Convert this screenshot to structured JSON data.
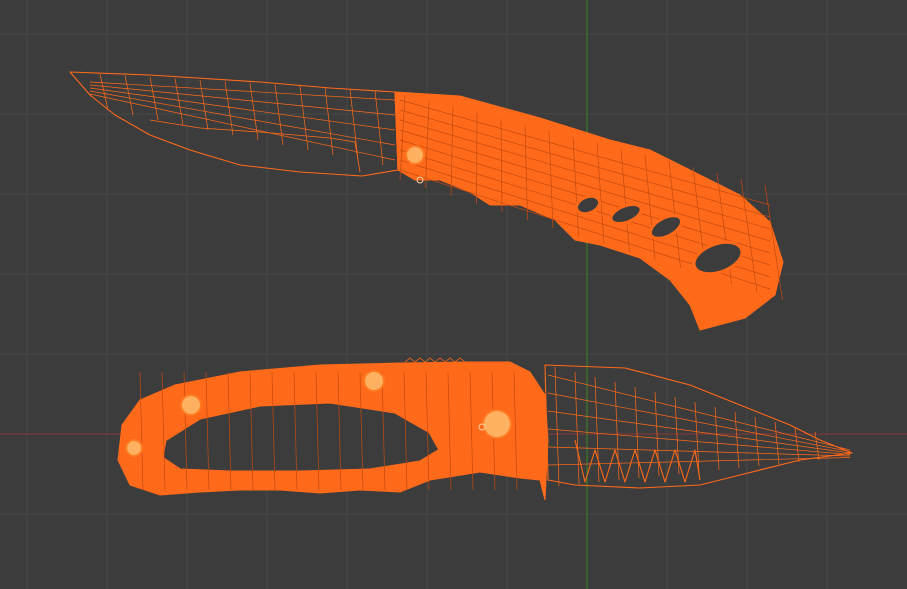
{
  "viewport": {
    "type": "3d-viewport-wireframe",
    "colors": {
      "background": "#3c3c3c",
      "grid": "#474747",
      "x_axis": "#7a3a3a",
      "y_axis": "#3d7a2a",
      "selected_wire": "#ff6a1a",
      "highlight": "#ffb060"
    }
  },
  "objects": [
    {
      "name": "knife-open-side-view",
      "selected": true
    },
    {
      "name": "knife-closed-side-view",
      "selected": true
    }
  ]
}
